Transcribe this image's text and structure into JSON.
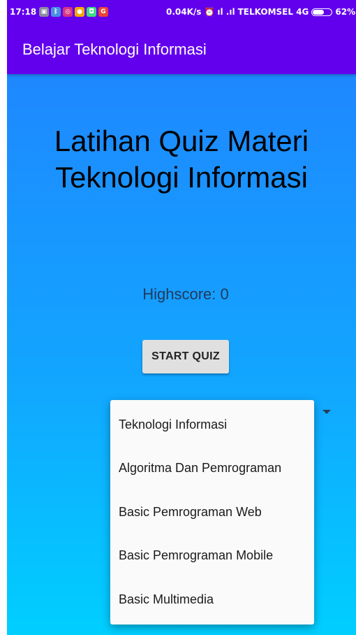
{
  "status_bar": {
    "time": "17:18",
    "left_icons": [
      {
        "name": "gallery-icon",
        "color": "#8a8aa0"
      },
      {
        "name": "bluetooth-icon",
        "color": "#4a90e2"
      },
      {
        "name": "instagram-icon",
        "color": "#d63384"
      },
      {
        "name": "app-icon",
        "color": "#f2a900"
      },
      {
        "name": "android-icon",
        "color": "#3ddc84"
      },
      {
        "name": "google-icon",
        "color": "#ea4335"
      }
    ],
    "network_speed": "0.04K/s",
    "alarm_glyph": "⏰",
    "signal_glyph": "ıl .ıl",
    "carrier": "TELKOMSEL 4G",
    "battery_percent": "62%",
    "battery_level": 0.62
  },
  "app_bar": {
    "title": "Belajar Teknologi Informasi",
    "color": "#6200ee"
  },
  "main": {
    "heading_line1": "Latihan Quiz Materi",
    "heading_line2": "Teknologi Informasi",
    "highscore": "Highscore: 0",
    "start_button_label": "START QUIZ"
  },
  "dropdown": {
    "items": [
      "Teknologi Informasi",
      "Algoritma Dan Pemrograman",
      "Basic Pemrograman Web",
      "Basic Pemrograman Mobile",
      "Basic Multimedia"
    ]
  }
}
